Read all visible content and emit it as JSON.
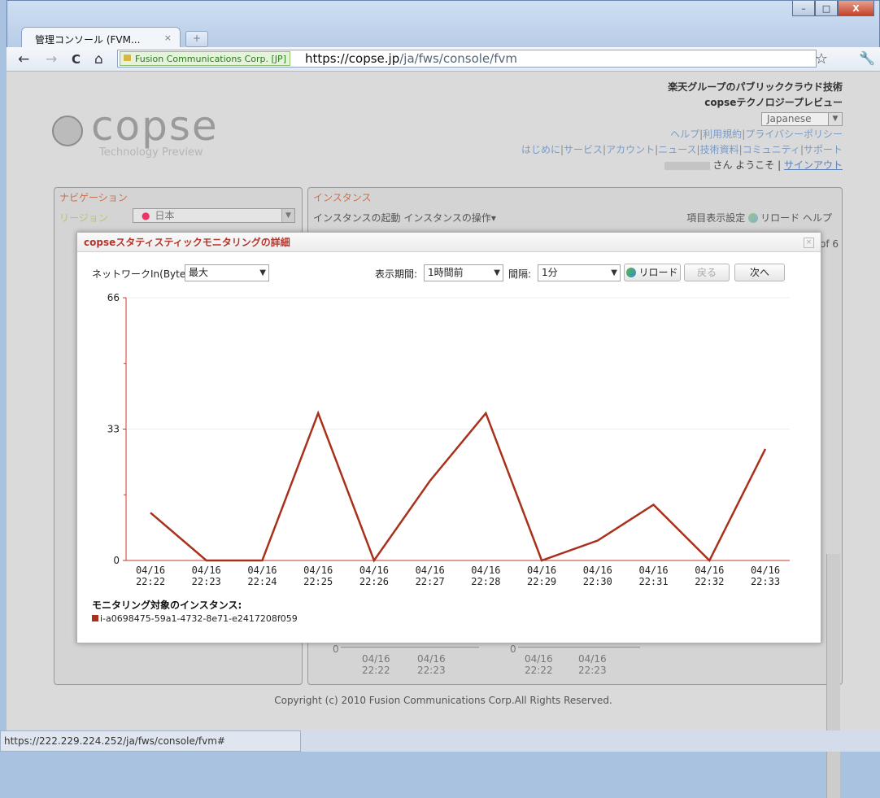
{
  "browser": {
    "tab_title": "管理コンソール (FVM...",
    "tab_close": "×",
    "new_tab": "+",
    "back": "←",
    "forward": "→",
    "reload": "C",
    "home": "⌂",
    "cert_label": "Fusion Communications Corp. [JP]",
    "url_host": "https://copse.jp",
    "url_path": "/ja/fws/console/fvm",
    "star": "☆",
    "wrench": "🔧",
    "status_url": "https://222.229.224.252/ja/fws/console/fvm#",
    "win_min": "–",
    "win_max": "□",
    "win_close": "X"
  },
  "header": {
    "logo_text": "copse",
    "logo_sub": "Technology Preview",
    "tagline1": "楽天グループのパブリッククラウド技術",
    "tagline2": "copseテクノロジープレビュー",
    "language": "Japanese",
    "links1": [
      "ヘルプ",
      "利用規約",
      "プライバシーポリシー"
    ],
    "links2": [
      "はじめに",
      "サービス",
      "アカウント",
      "ニュース",
      "技術資料",
      "コミュニティ",
      "サポート"
    ],
    "welcome_suffix": "さん ようこそ",
    "signout": "サインアウト"
  },
  "nav_panel": {
    "title": "ナビゲーション",
    "region_label": "リージョン",
    "region_value": "日本"
  },
  "instance_panel": {
    "title": "インスタンス",
    "launch": "インスタンスの起動",
    "actions": "インスタンスの操作▾",
    "columns": "項目表示設定",
    "reload": "リロード",
    "help": "ヘルプ",
    "page_info": "of 6",
    "mini_zero": "0",
    "mini_ticks": [
      "04/16",
      "22:22",
      "04/16",
      "22:23"
    ]
  },
  "modal": {
    "title": "copseスタティスティックモニタリングの詳細",
    "close": "×",
    "metric_label": "ネットワークIn(Bytes)",
    "metric_value": "最大",
    "period_label": "表示期間:",
    "period_value": "1時間前",
    "interval_label": "間隔:",
    "interval_value": "1分",
    "reload": "リロード",
    "back": "戻る",
    "next": "次へ",
    "legend_title": "モニタリング対象のインスタンス:",
    "legend_item": "i-a0698475-59a1-4732-8e71-e2417208f059"
  },
  "footer": {
    "copyright": "Copyright (c) 2010 Fusion Communications Corp.All Rights Reserved."
  },
  "colors": {
    "series": "#a8311c",
    "axis": "#c0392b"
  },
  "chart_data": {
    "type": "line",
    "categories": [
      "04/16\n22:22",
      "04/16\n22:23",
      "04/16\n22:24",
      "04/16\n22:25",
      "04/16\n22:26",
      "04/16\n22:27",
      "04/16\n22:28",
      "04/16\n22:29",
      "04/16\n22:30",
      "04/16\n22:31",
      "04/16\n22:32",
      "04/16\n22:33"
    ],
    "series": [
      {
        "name": "i-a0698475-59a1-4732-8e71-e2417208f059",
        "values": [
          12,
          0,
          0,
          37,
          0,
          20,
          37,
          0,
          5,
          14,
          0,
          28
        ]
      }
    ],
    "yticks": [
      0,
      33,
      66
    ],
    "ylim": [
      0,
      66
    ]
  }
}
